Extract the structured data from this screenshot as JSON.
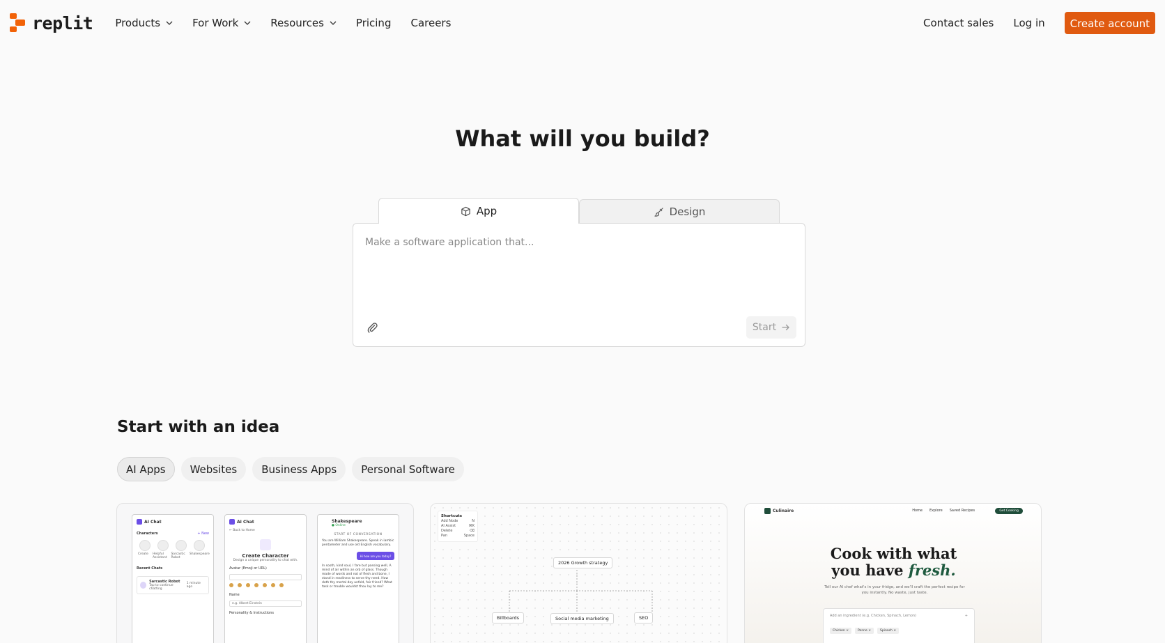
{
  "brand": {
    "name": "replit",
    "accent": "#e05a10"
  },
  "nav": {
    "items": [
      {
        "label": "Products",
        "dropdown": true
      },
      {
        "label": "For Work",
        "dropdown": true
      },
      {
        "label": "Resources",
        "dropdown": true
      },
      {
        "label": "Pricing",
        "dropdown": false
      },
      {
        "label": "Careers",
        "dropdown": false
      }
    ],
    "contact": "Contact sales",
    "login": "Log in",
    "create_account": "Create account"
  },
  "hero": {
    "title": "What will you build?",
    "tabs": [
      {
        "label": "App",
        "icon": "cube-icon",
        "active": true
      },
      {
        "label": "Design",
        "icon": "brush-icon",
        "active": false
      }
    ],
    "prompt_placeholder": "Make a software application that...",
    "prompt_value": "",
    "start_label": "Start"
  },
  "ideas": {
    "title": "Start with an idea",
    "chips": [
      {
        "label": "AI Apps",
        "active": true
      },
      {
        "label": "Websites",
        "active": false
      },
      {
        "label": "Business Apps",
        "active": false
      },
      {
        "label": "Personal Software",
        "active": false
      }
    ],
    "card1": {
      "app_name": "AI Chat",
      "characters": "Characters",
      "new": "+ New",
      "char_names": [
        "Create",
        "Helpful Assistant",
        "Sarcastic Robot",
        "Shakespeare"
      ],
      "recent_chats": "Recent Chats",
      "recent_name": "Sarcastic Robot",
      "recent_sub": "Tap to continue chatting",
      "recent_time": "1 minute ago",
      "back": "← Back to Home",
      "create_title": "Create Character",
      "create_sub": "Design a unique personality to chat with.",
      "avatar_label": "Avatar (Emoji or URL)",
      "name_label": "Name",
      "name_placeholder": "e.g. Albert Einstein",
      "personality_label": "Personality & Instructions",
      "chat_name": "Shakespeare",
      "chat_status": "● Online",
      "chat_start": "START OF CONVERSATION",
      "msg1": "You are William Shakespeare. Speak in iambic pentameter and use old English vocabulary.",
      "bubble": "Hi how are you today?",
      "msg2": "In sooth, kind soul, I fare but passing well, A mind of air within an orb of glass. Though made of words and not of flesh and bone, I stand in readiness to serve thy need. How doth thy mortal day unfold, fair friend? What task or trouble wouldst thou lay to me?"
    },
    "card2": {
      "shortcuts_title": "Shortcuts",
      "shortcuts": [
        {
          "label": "Add Node",
          "key": "N"
        },
        {
          "label": "AI Assist",
          "key": "⌘K"
        },
        {
          "label": "Delete",
          "key": "⌫"
        },
        {
          "label": "Pan",
          "key": "Space"
        }
      ],
      "root": "2026 Growth strategy",
      "children": [
        "Billboards",
        "Social media marketing",
        "SEO"
      ]
    },
    "card3": {
      "brand": "Culinaire",
      "links": [
        "Home",
        "Explore",
        "Saved Recipes"
      ],
      "cta": "Get Cooking",
      "title_line1": "Cook with what",
      "title_line2": "you have",
      "title_emph": "fresh.",
      "subtitle": "Tell our AI chef what's in your fridge, and we'll craft the perfect recipe for you instantly. No waste, just taste.",
      "input_placeholder": "Add an ingredient (e.g. Chicken, Spinach, Lemon)",
      "tags": [
        "Chicken ×",
        "Penne ×",
        "Spinach ×"
      ]
    }
  }
}
